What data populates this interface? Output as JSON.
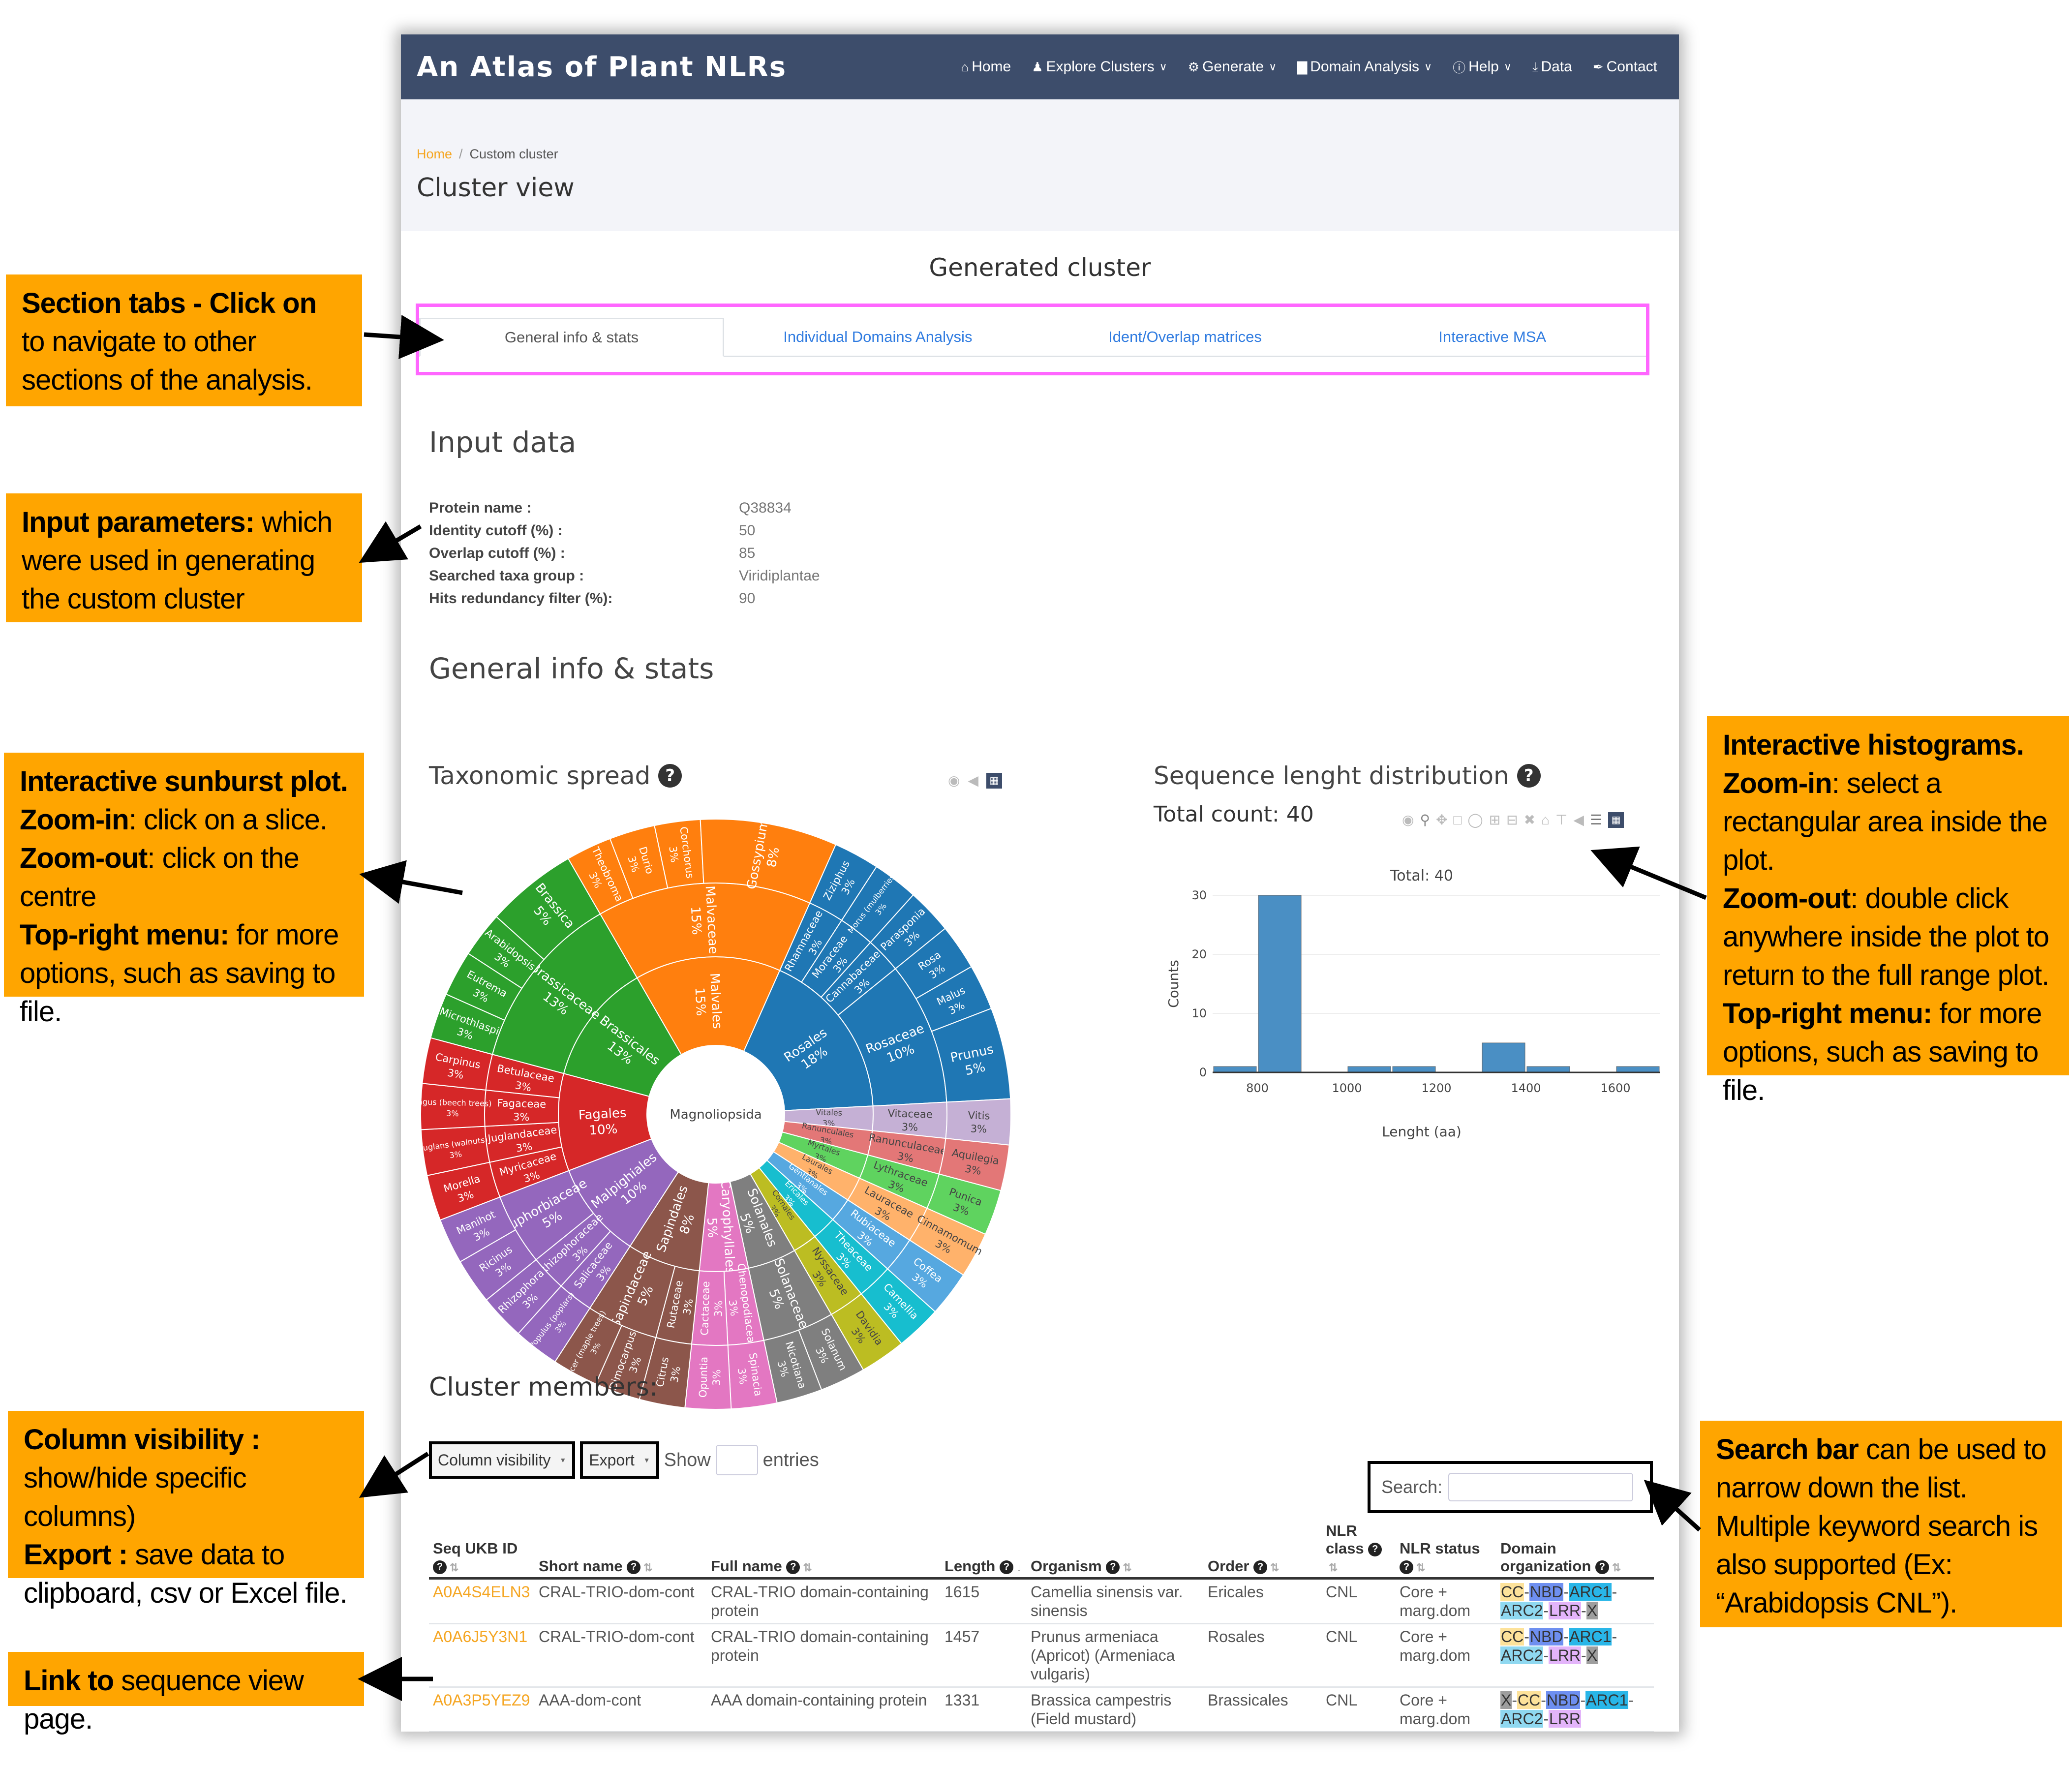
{
  "app": {
    "title": "An Atlas of Plant NLRs"
  },
  "nav": [
    {
      "label": "Home",
      "icon": "home-icon",
      "glyph": "⌂",
      "dropdown": false
    },
    {
      "label": "Explore Clusters",
      "icon": "user-icon",
      "glyph": "♟",
      "dropdown": true
    },
    {
      "label": "Generate",
      "icon": "gear-icon",
      "glyph": "⚙",
      "dropdown": true
    },
    {
      "label": "Domain Analysis",
      "icon": "bar-chart-icon",
      "glyph": "▇",
      "dropdown": true
    },
    {
      "label": "Help",
      "icon": "info-icon",
      "glyph": "ⓘ",
      "dropdown": true
    },
    {
      "label": "Data",
      "icon": "download-icon",
      "glyph": "⤓",
      "dropdown": false
    },
    {
      "label": "Contact",
      "icon": "feather-icon",
      "glyph": "✒",
      "dropdown": false
    }
  ],
  "breadcrumb": {
    "home": "Home",
    "separator": "/",
    "current": "Custom cluster"
  },
  "page_title": "Cluster view",
  "generated_title": "Generated cluster",
  "tabs": [
    {
      "label": "General info & stats",
      "active": true
    },
    {
      "label": "Individual Domains Analysis",
      "active": false
    },
    {
      "label": "Ident/Overlap matrices",
      "active": false
    },
    {
      "label": "Interactive MSA",
      "active": false
    }
  ],
  "input_data": {
    "title": "Input data",
    "rows": [
      {
        "label": "Protein name :",
        "value": "Q38834"
      },
      {
        "label": "Identity cutoff (%) :",
        "value": "50"
      },
      {
        "label": "Overlap cutoff (%) :",
        "value": "85"
      },
      {
        "label": "Searched taxa group :",
        "value": "Viridiplantae"
      },
      {
        "label": "Hits redundancy filter (%):",
        "value": "90"
      }
    ]
  },
  "stats_title": "General info & stats",
  "taxonomy": {
    "title": "Taxonomic spread",
    "help": "?",
    "toolbar": [
      "camera-icon",
      "plotly-tag-icon",
      "plotly-logo-icon"
    ]
  },
  "seqlen": {
    "title": "Sequence lenght distribution",
    "help": "?",
    "total_count_label": "Total count: 40",
    "toolbar": [
      "camera-icon",
      "zoom-icon",
      "pan-icon",
      "box-select-icon",
      "lasso-icon",
      "zoom-in-icon",
      "zoom-out-icon",
      "autoscale-icon",
      "reset-axes-icon",
      "spike-lines-icon",
      "hover-closest-icon",
      "hover-compare-icon",
      "plotly-logo-icon"
    ]
  },
  "chart_data": [
    {
      "type": "sunburst",
      "title": "Taxonomic spread",
      "root": "Magnoliopsida",
      "total": 40,
      "orders": [
        {
          "name": "Malvales",
          "pct": "15%",
          "color": "#ff7f0e",
          "families": [
            {
              "name": "Malvaceae",
              "pct": "15%",
              "genera": [
                {
                  "name": "Theobroma",
                  "count": 1,
                  "pct": "3%"
                },
                {
                  "name": "Durio",
                  "count": 1,
                  "pct": "3%"
                },
                {
                  "name": "Corchorus",
                  "count": 1,
                  "pct": "3%"
                },
                {
                  "name": "Gossypium",
                  "count": 3,
                  "pct": "8%"
                }
              ]
            }
          ]
        },
        {
          "name": "Rosales",
          "pct": "18%",
          "color": "#1f77b4",
          "families": [
            {
              "name": "Rhamnaceae",
              "pct": "3%",
              "genera": [
                {
                  "name": "Ziziphus",
                  "count": 1,
                  "pct": "3%"
                }
              ]
            },
            {
              "name": "Moraceae",
              "pct": "3%",
              "genera": [
                {
                  "name": "Morus (mulberries)",
                  "count": 1,
                  "pct": "3%"
                }
              ]
            },
            {
              "name": "Cannabaceae",
              "pct": "3%",
              "genera": [
                {
                  "name": "Parasponia",
                  "count": 1,
                  "pct": "3%"
                }
              ]
            },
            {
              "name": "Rosaceae",
              "pct": "10%",
              "genera": [
                {
                  "name": "Rosa",
                  "count": 1,
                  "pct": "3%"
                },
                {
                  "name": "Malus",
                  "count": 1,
                  "pct": "3%"
                },
                {
                  "name": "Prunus",
                  "count": 2,
                  "pct": "5%"
                }
              ]
            }
          ]
        },
        {
          "name": "Vitales",
          "pct": "3%",
          "color": "#c5b0d5",
          "families": [
            {
              "name": "Vitaceae",
              "pct": "3%",
              "genera": [
                {
                  "name": "Vitis",
                  "count": 1,
                  "pct": "3%"
                }
              ]
            }
          ]
        },
        {
          "name": "Ranunculales",
          "pct": "3%",
          "color": "#e37777",
          "families": [
            {
              "name": "Ranunculaceae",
              "pct": "3%",
              "genera": [
                {
                  "name": "Aquilegia",
                  "count": 1,
                  "pct": "3%"
                }
              ]
            }
          ]
        },
        {
          "name": "Myrtales",
          "pct": "3%",
          "color": "#5fd35f",
          "families": [
            {
              "name": "Lythraceae",
              "pct": "3%",
              "genera": [
                {
                  "name": "Punica",
                  "count": 1,
                  "pct": "3%"
                }
              ]
            }
          ]
        },
        {
          "name": "Laurales",
          "pct": "3%",
          "color": "#ffb26b",
          "families": [
            {
              "name": "Lauraceae",
              "pct": "3%",
              "genera": [
                {
                  "name": "Cinnamomum",
                  "count": 1,
                  "pct": "3%"
                }
              ]
            }
          ]
        },
        {
          "name": "Gentianales",
          "pct": "3%",
          "color": "#56a8e0",
          "families": [
            {
              "name": "Rubiaceae",
              "pct": "3%",
              "genera": [
                {
                  "name": "Coffea",
                  "count": 1,
                  "pct": "3%"
                }
              ]
            }
          ]
        },
        {
          "name": "Ericales",
          "pct": "3%",
          "color": "#17becf",
          "families": [
            {
              "name": "Theaceae",
              "pct": "3%",
              "genera": [
                {
                  "name": "Camellia",
                  "count": 1,
                  "pct": "3%"
                }
              ]
            }
          ]
        },
        {
          "name": "Cornales",
          "pct": "3%",
          "color": "#bcbd22",
          "families": [
            {
              "name": "Nyssaceae",
              "pct": "3%",
              "genera": [
                {
                  "name": "Davidia",
                  "count": 1,
                  "pct": "3%"
                }
              ]
            }
          ]
        },
        {
          "name": "Solanales",
          "pct": "5%",
          "color": "#7f7f7f",
          "families": [
            {
              "name": "Solanaceae",
              "pct": "5%",
              "genera": [
                {
                  "name": "Solanum",
                  "count": 1,
                  "pct": "3%"
                },
                {
                  "name": "Nicotiana",
                  "count": 1,
                  "pct": "3%"
                }
              ]
            }
          ]
        },
        {
          "name": "Caryophyllales",
          "pct": "5%",
          "color": "#e377c2",
          "families": [
            {
              "name": "Chenopodiaceae",
              "pct": "3%",
              "genera": [
                {
                  "name": "Spinacia",
                  "count": 1,
                  "pct": "3%"
                }
              ]
            },
            {
              "name": "Cactaceae",
              "pct": "3%",
              "genera": [
                {
                  "name": "Opuntia",
                  "count": 1,
                  "pct": "3%"
                }
              ]
            }
          ]
        },
        {
          "name": "Sapindales",
          "pct": "8%",
          "color": "#8c564b",
          "families": [
            {
              "name": "Rutaceae",
              "pct": "3%",
              "genera": [
                {
                  "name": "Citrus",
                  "count": 1,
                  "pct": "3%"
                }
              ]
            },
            {
              "name": "Sapindaceae",
              "pct": "5%",
              "genera": [
                {
                  "name": "Dimocarpus",
                  "count": 1,
                  "pct": "3%"
                },
                {
                  "name": "Acer (maple trees)",
                  "count": 1,
                  "pct": "3%"
                }
              ]
            }
          ]
        },
        {
          "name": "Malpighiales",
          "pct": "10%",
          "color": "#9467bd",
          "families": [
            {
              "name": "Salicaceae",
              "pct": "3%",
              "genera": [
                {
                  "name": "Populus (poplars)",
                  "count": 1,
                  "pct": "3%"
                }
              ]
            },
            {
              "name": "Rhizophoraceae",
              "pct": "3%",
              "genera": [
                {
                  "name": "Rhizophora",
                  "count": 1,
                  "pct": "3%"
                }
              ]
            },
            {
              "name": "Euphorbiaceae",
              "pct": "5%",
              "genera": [
                {
                  "name": "Ricinus",
                  "count": 1,
                  "pct": "3%"
                },
                {
                  "name": "Manihot",
                  "count": 1,
                  "pct": "3%"
                }
              ]
            }
          ]
        },
        {
          "name": "Fagales",
          "pct": "10%",
          "color": "#d62728",
          "families": [
            {
              "name": "Myricaceae",
              "pct": "3%",
              "genera": [
                {
                  "name": "Morella",
                  "count": 1,
                  "pct": "3%"
                }
              ]
            },
            {
              "name": "Juglandaceae",
              "pct": "3%",
              "genera": [
                {
                  "name": "Juglans (walnuts)",
                  "count": 1,
                  "pct": "3%"
                }
              ]
            },
            {
              "name": "Fagaceae",
              "pct": "3%",
              "genera": [
                {
                  "name": "Fagus (beech trees)",
                  "count": 1,
                  "pct": "3%"
                }
              ]
            },
            {
              "name": "Betulaceae",
              "pct": "3%",
              "genera": [
                {
                  "name": "Carpinus",
                  "count": 1,
                  "pct": "3%"
                }
              ]
            }
          ]
        },
        {
          "name": "Brassicales",
          "pct": "13%",
          "color": "#2ca02c",
          "families": [
            {
              "name": "Brassicaceae",
              "pct": "13%",
              "genera": [
                {
                  "name": "Microthlaspi",
                  "count": 1,
                  "pct": "3%"
                },
                {
                  "name": "Eutrema",
                  "count": 1,
                  "pct": "3%"
                },
                {
                  "name": "Arabidopsis",
                  "count": 1,
                  "pct": "3%"
                },
                {
                  "name": "Brassica",
                  "count": 2,
                  "pct": "5%"
                }
              ]
            }
          ]
        }
      ]
    },
    {
      "type": "bar",
      "title": "Total: 40",
      "xlabel": "Lenght (aa)",
      "ylabel": "Counts",
      "bin_size": 100,
      "bins": [
        {
          "start": 700,
          "end": 800,
          "count": 1
        },
        {
          "start": 800,
          "end": 900,
          "count": 30
        },
        {
          "start": 900,
          "end": 1000,
          "count": 0
        },
        {
          "start": 1000,
          "end": 1100,
          "count": 1
        },
        {
          "start": 1100,
          "end": 1200,
          "count": 1
        },
        {
          "start": 1200,
          "end": 1300,
          "count": 0
        },
        {
          "start": 1300,
          "end": 1400,
          "count": 5
        },
        {
          "start": 1400,
          "end": 1500,
          "count": 1
        },
        {
          "start": 1500,
          "end": 1600,
          "count": 0
        },
        {
          "start": 1600,
          "end": 1700,
          "count": 1
        }
      ],
      "xlim": [
        700,
        1700
      ],
      "ylim": [
        0,
        30
      ],
      "xticks": [
        800,
        1000,
        1200,
        1400,
        1600
      ],
      "yticks": [
        0,
        10,
        20,
        30
      ],
      "grid": true,
      "color": "#4a8fc4"
    }
  ],
  "members": {
    "title": "Cluster members:",
    "column_visibility": "Column visibility",
    "export": "Export",
    "show": "Show",
    "entries": "entries",
    "search_label": "Search:",
    "search_value": "",
    "columns": [
      {
        "label": "Seq UKB ID",
        "sort": "⇅"
      },
      {
        "label": "Short name",
        "sort": "⇅"
      },
      {
        "label": "Full name",
        "sort": "⇅"
      },
      {
        "label": "Length",
        "sort": "↓"
      },
      {
        "label": "Organism",
        "sort": "⇅"
      },
      {
        "label": "Order",
        "sort": "⇅"
      },
      {
        "label": "NLR class",
        "sort": "⇅"
      },
      {
        "label": "NLR status",
        "sort": "⇅"
      },
      {
        "label": "Domain organization",
        "sort": "⇅"
      }
    ],
    "rows": [
      {
        "id": "A0A4S4ELN3",
        "short": "CRAL-TRIO-dom-cont",
        "full": "CRAL-TRIO domain-containing protein",
        "length": "1615",
        "organism": "Camellia sinensis var. sinensis",
        "order": "Ericales",
        "class": "CNL",
        "status": "Core + marg.dom",
        "domains": [
          "CC",
          "NBD",
          "ARC1",
          "ARC2",
          "LRR",
          "X"
        ]
      },
      {
        "id": "A0A6J5Y3N1",
        "short": "CRAL-TRIO-dom-cont",
        "full": "CRAL-TRIO domain-containing protein",
        "length": "1457",
        "organism": "Prunus armeniaca (Apricot) (Armeniaca vulgaris)",
        "order": "Rosales",
        "class": "CNL",
        "status": "Core + marg.dom",
        "domains": [
          "CC",
          "NBD",
          "ARC1",
          "ARC2",
          "LRR",
          "X"
        ]
      },
      {
        "id": "A0A3P5YEZ9",
        "short": "AAA-dom-cont",
        "full": "AAA domain-containing protein",
        "length": "1331",
        "organism": "Brassica campestris (Field mustard)",
        "order": "Brassicales",
        "class": "CNL",
        "status": "Core + marg.dom",
        "domains": [
          "X",
          "CC",
          "NBD",
          "ARC1",
          "ARC2",
          "LRR"
        ]
      }
    ],
    "domain_colors": {
      "CC": "#fde29a",
      "NBD": "#6e8ff0",
      "ARC1": "#29b6e8",
      "ARC2": "#8fd8f0",
      "LRR": "#e3b4fa",
      "X": "#9e9e9e"
    }
  },
  "annotations": [
    {
      "id": "tabs",
      "bold": "Section tabs - Click on",
      "text": " to navigate to other sections of the analysis."
    },
    {
      "id": "params",
      "bold": "Input parameters:",
      "text": " which were used in generating the custom cluster"
    },
    {
      "id": "sunburst",
      "parts": [
        {
          "bold": "Interactive sunburst plot.",
          "text": ""
        },
        {
          "bold": "Zoom-in",
          "text": ": click on a slice."
        },
        {
          "bold": "Zoom-out",
          "text": ": click on the centre"
        },
        {
          "bold": "Top-right menu:",
          "text": " for more options, such as saving to file."
        }
      ]
    },
    {
      "id": "hist",
      "parts": [
        {
          "bold": "Interactive histograms.",
          "text": ""
        },
        {
          "bold": "Zoom-in",
          "text": ": select a rectangular area inside the plot."
        },
        {
          "bold": "Zoom-out",
          "text": ": double click anywhere inside the plot to return to the full range plot."
        },
        {
          "bold": "Top-right menu:",
          "text": " for more options, such as saving to file."
        }
      ]
    },
    {
      "id": "colvis",
      "parts": [
        {
          "bold": "Column visibility :",
          "text": " show/hide specific columns)"
        },
        {
          "bold": "Export :",
          "text": " save data to clipboard, csv or Excel file."
        }
      ]
    },
    {
      "id": "link",
      "bold": "Link to",
      "text": " sequence view page."
    },
    {
      "id": "search",
      "bold": "Search bar",
      "text": " can be used to narrow down the list. Multiple keyword search is also supported (Ex: “Arabidopsis CNL”)."
    }
  ]
}
